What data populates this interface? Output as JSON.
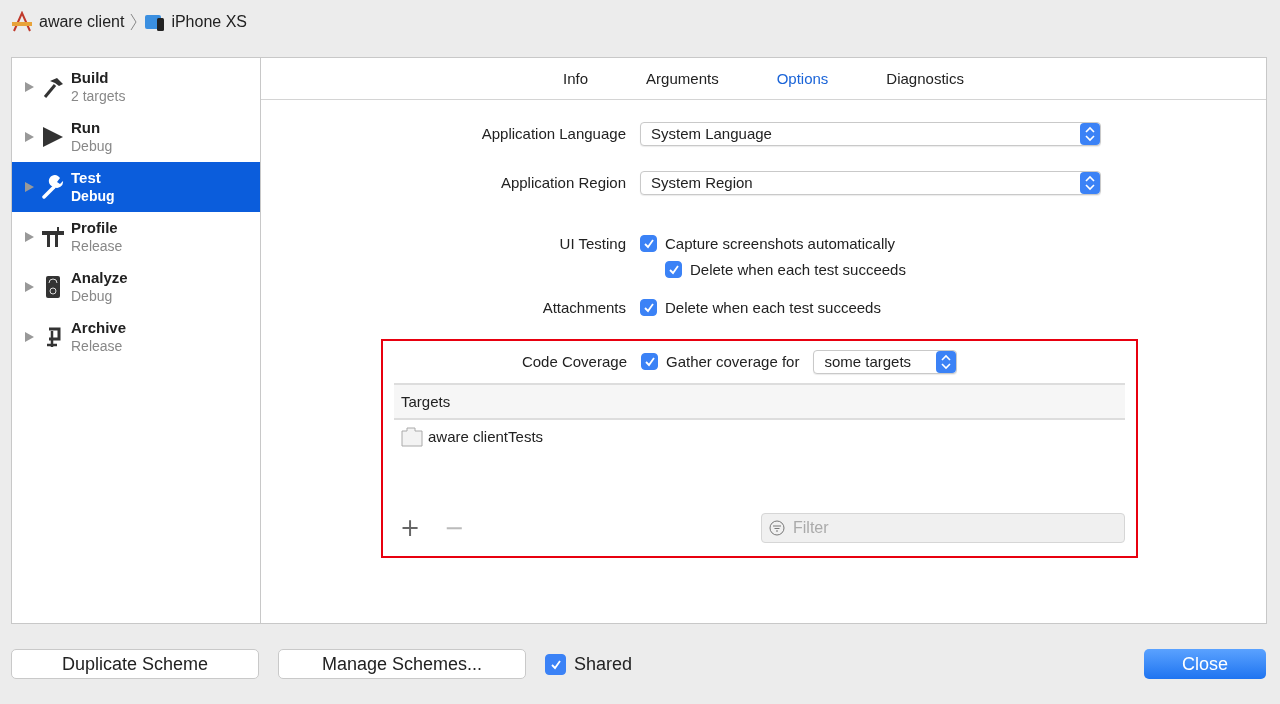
{
  "breadcrumb": {
    "project": "aware client",
    "device": "iPhone XS"
  },
  "sidebar": {
    "items": [
      {
        "kind": "build",
        "title": "Build",
        "subtitle": "2 targets",
        "selected": false
      },
      {
        "kind": "run",
        "title": "Run",
        "subtitle": "Debug",
        "selected": false
      },
      {
        "kind": "test",
        "title": "Test",
        "subtitle": "Debug",
        "selected": true
      },
      {
        "kind": "profile",
        "title": "Profile",
        "subtitle": "Release",
        "selected": false
      },
      {
        "kind": "analyze",
        "title": "Analyze",
        "subtitle": "Debug",
        "selected": false
      },
      {
        "kind": "archive",
        "title": "Archive",
        "subtitle": "Release",
        "selected": false
      }
    ]
  },
  "tabs": [
    {
      "label": "Info",
      "selected": false
    },
    {
      "label": "Arguments",
      "selected": false
    },
    {
      "label": "Options",
      "selected": true
    },
    {
      "label": "Diagnostics",
      "selected": false
    }
  ],
  "options": [
    {
      "kind": "popup",
      "label": "Application Language",
      "value": "System Language"
    },
    {
      "kind": "popup",
      "label": "Application Region",
      "value": "System Region"
    },
    {
      "kind": "checks",
      "label": "UI Testing",
      "checks": [
        {
          "label": "Capture screenshots automatically",
          "checked": true,
          "children": [
            {
              "label": "Delete when each test succeeds",
              "checked": true
            }
          ]
        }
      ]
    },
    {
      "kind": "checks",
      "label": "Attachments",
      "checks": [
        {
          "label": "Delete when each test succeeds",
          "checked": true
        }
      ]
    }
  ],
  "coverage": {
    "highlighted": true,
    "label": "Code Coverage",
    "check": {
      "label": "Gather coverage for",
      "checked": true
    },
    "popup": "some targets",
    "table": {
      "columns": [
        "Targets"
      ],
      "rows": [
        {
          "name": "aware clientTests"
        }
      ]
    },
    "add": "+",
    "remove": "−",
    "filter": {
      "placeholder": "Filter"
    }
  },
  "footer": {
    "buttons": [
      "Duplicate Scheme",
      "Manage Schemes..."
    ],
    "shared": {
      "label": "Shared",
      "checked": true
    },
    "close": "Close"
  }
}
